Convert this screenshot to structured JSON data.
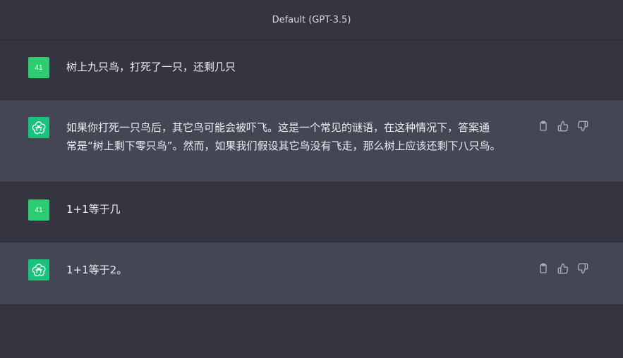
{
  "header": {
    "title": "Default (GPT-3.5)"
  },
  "messages": [
    {
      "role": "user",
      "avatar_text": "41",
      "text": "树上九只鸟，打死了一只，还剩几只"
    },
    {
      "role": "assistant",
      "text": "如果你打死一只鸟后，其它鸟可能会被吓飞。这是一个常见的谜语，在这种情况下，答案通\n常是“树上剩下零只鸟”。然而，如果我们假设其它鸟没有飞走，那么树上应该还剩下八只鸟。"
    },
    {
      "role": "user",
      "avatar_text": "41",
      "text": "1+1等于几"
    },
    {
      "role": "assistant",
      "text": "1+1等于2。"
    }
  ],
  "colors": {
    "user_bg": "#343541",
    "assistant_bg": "#444654",
    "user_avatar": "#2ecc71",
    "bot_avatar": "#19c37d"
  },
  "icons": [
    "clipboard-icon",
    "thumbs-up-icon",
    "thumbs-down-icon",
    "openai-logo-icon"
  ]
}
